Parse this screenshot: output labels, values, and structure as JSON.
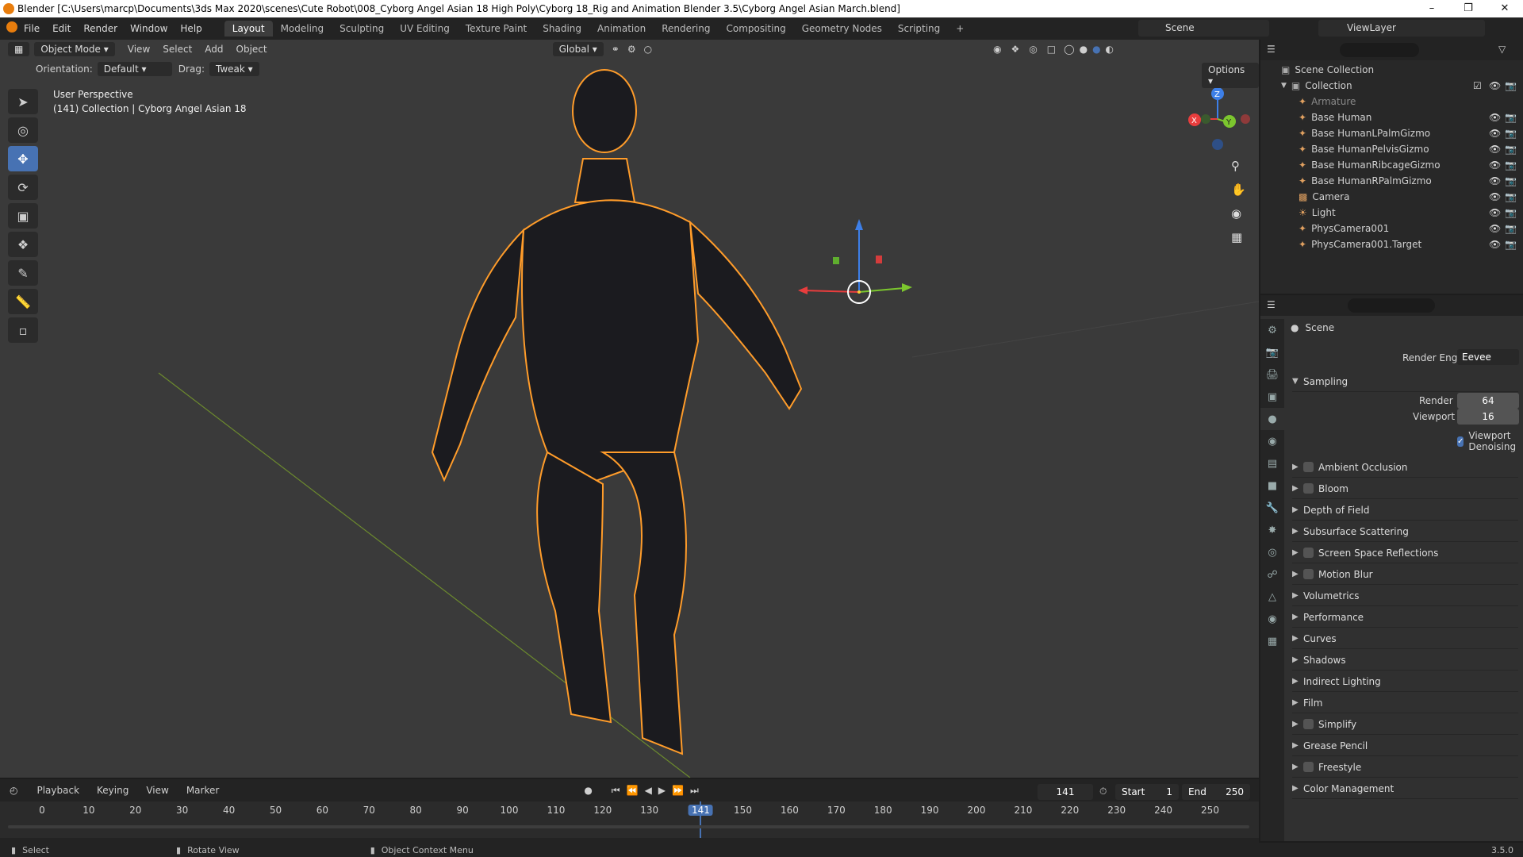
{
  "title": "Blender [C:\\Users\\marcp\\Documents\\3ds Max 2020\\scenes\\Cute Robot\\008_Cyborg Angel Asian 18 High Poly\\Cyborg 18_Rig and Animation Blender 3.5\\Cyborg Angel Asian March.blend]",
  "menu": [
    "File",
    "Edit",
    "Render",
    "Window",
    "Help"
  ],
  "workspaces": [
    "Layout",
    "Modeling",
    "Sculpting",
    "UV Editing",
    "Texture Paint",
    "Shading",
    "Animation",
    "Rendering",
    "Compositing",
    "Geometry Nodes",
    "Scripting",
    "+"
  ],
  "scene": "Scene",
  "view_layer": "ViewLayer",
  "viewport": {
    "mode": "Object Mode",
    "menus": [
      "View",
      "Select",
      "Add",
      "Object"
    ],
    "transform": "Global",
    "orientation_label": "Orientation:",
    "orientation": "Default",
    "drag_label": "Drag:",
    "drag": "Tweak",
    "options": "Options",
    "perspective": "User Perspective",
    "collection_info": "(141) Collection | Cyborg Angel Asian 18",
    "gizmo_x": "X",
    "gizmo_y": "Y",
    "gizmo_z": "Z"
  },
  "outliner": {
    "root": "Scene Collection",
    "collection": "Collection",
    "items": [
      "Armature",
      "Base Human",
      "Base HumanLPalmGizmo",
      "Base HumanPelvisGizmo",
      "Base HumanRibcageGizmo",
      "Base HumanRPalmGizmo",
      "Camera",
      "Light",
      "PhysCamera001",
      "PhysCamera001.Target"
    ]
  },
  "properties": {
    "header": "Scene",
    "render_engine_label": "Render Engine",
    "render_engine": "Eevee",
    "sampling": "Sampling",
    "render_label": "Render",
    "render_value": "64",
    "viewport_label": "Viewport",
    "viewport_value": "16",
    "viewport_denoising": "Viewport Denoising",
    "panels": [
      "Ambient Occlusion",
      "Bloom",
      "Depth of Field",
      "Subsurface Scattering",
      "Screen Space Reflections",
      "Motion Blur",
      "Volumetrics",
      "Performance",
      "Curves",
      "Shadows",
      "Indirect Lighting",
      "Film",
      "Simplify",
      "Grease Pencil",
      "Freestyle",
      "Color Management"
    ]
  },
  "timeline": {
    "menus": [
      "Playback",
      "Keying",
      "View",
      "Marker"
    ],
    "current_frame": "141",
    "start_label": "Start",
    "start": "1",
    "end_label": "End",
    "end": "250",
    "ticks": [
      "0",
      "10",
      "20",
      "30",
      "40",
      "50",
      "60",
      "70",
      "80",
      "90",
      "100",
      "110",
      "120",
      "130",
      "141",
      "150",
      "160",
      "170",
      "180",
      "190",
      "200",
      "210",
      "220",
      "230",
      "240",
      "250"
    ]
  },
  "status": {
    "select": "Select",
    "rotate": "Rotate View",
    "context": "Object Context Menu",
    "version": "3.5.0"
  },
  "colors": {
    "accent": "#4772b3",
    "selection_outline": "#ffa133",
    "frame_marker": "#4772b3"
  }
}
